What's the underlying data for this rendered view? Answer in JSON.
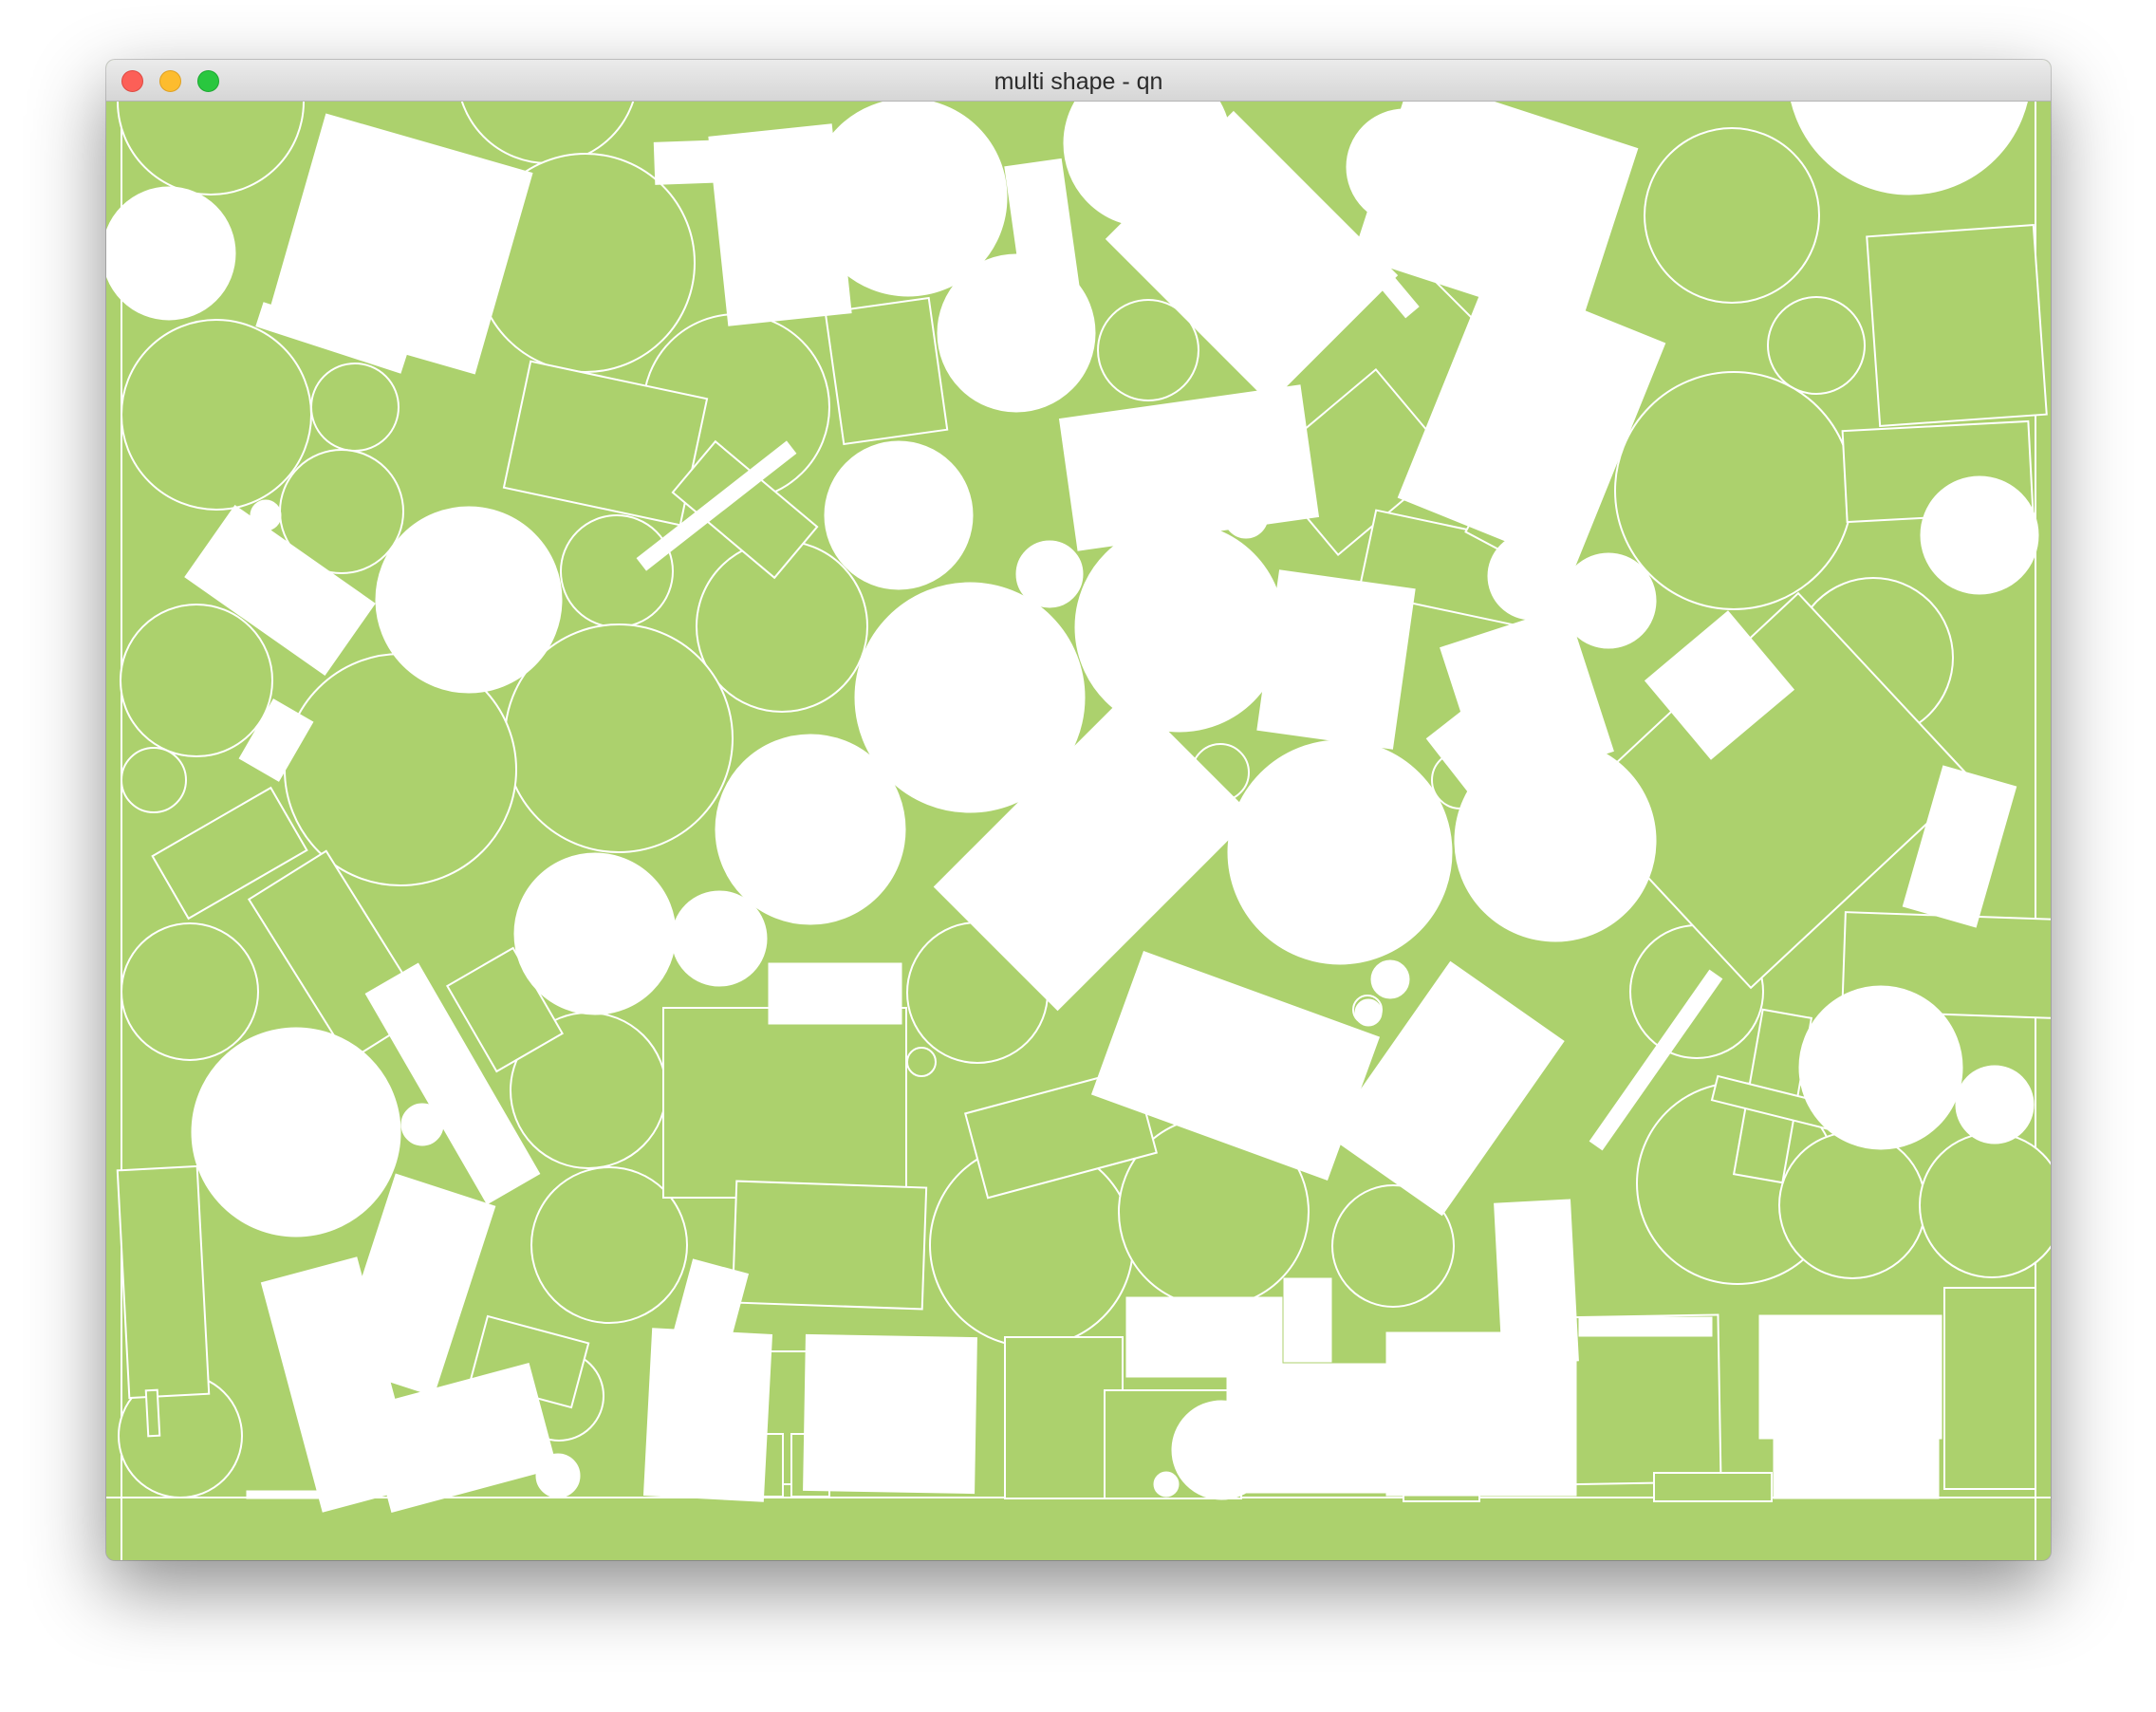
{
  "window": {
    "title": "multi shape - qn",
    "controls": {
      "close": "close-button",
      "minimize": "minimize-button",
      "zoom": "zoom-button"
    }
  },
  "scene": {
    "background_color": "#acd16d",
    "shape_fill_white": "#ffffff",
    "shape_fill_green": "#acd16d",
    "outline_color": "#ffffff",
    "shape_kinds": [
      "circle",
      "rectangle"
    ]
  }
}
